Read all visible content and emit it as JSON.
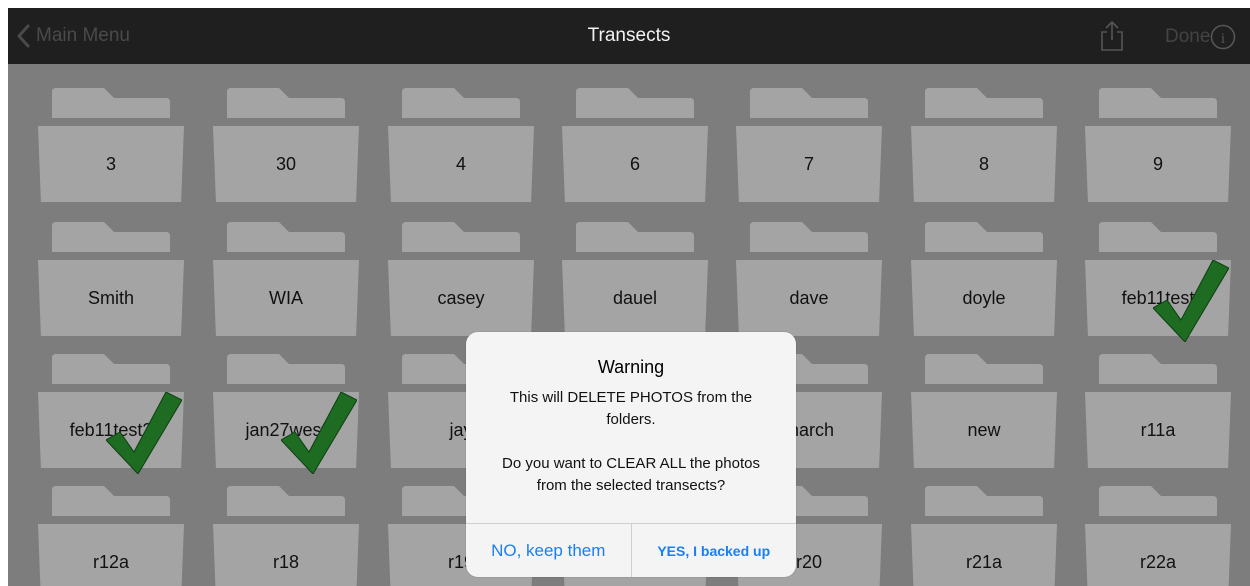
{
  "navbar": {
    "back_label": "Main Menu",
    "title": "Transects",
    "done_label": "Done",
    "share_icon": "share-icon",
    "info_icon": "info-icon"
  },
  "folders": [
    {
      "label": "3",
      "checked": false
    },
    {
      "label": "30",
      "checked": false
    },
    {
      "label": "4",
      "checked": false
    },
    {
      "label": "6",
      "checked": false
    },
    {
      "label": "7",
      "checked": false
    },
    {
      "label": "8",
      "checked": false
    },
    {
      "label": "9",
      "checked": false
    },
    {
      "label": "Smith",
      "checked": false
    },
    {
      "label": "WIA",
      "checked": false
    },
    {
      "label": "casey",
      "checked": false
    },
    {
      "label": "dauel",
      "checked": false
    },
    {
      "label": "dave",
      "checked": false
    },
    {
      "label": "doyle",
      "checked": false
    },
    {
      "label": "feb11test",
      "checked": true
    },
    {
      "label": "feb11test2",
      "checked": true
    },
    {
      "label": "jan27west",
      "checked": true
    },
    {
      "label": "jay",
      "checked": false
    },
    {
      "label": "",
      "checked": false
    },
    {
      "label": "march",
      "checked": false
    },
    {
      "label": "new",
      "checked": false
    },
    {
      "label": "r11a",
      "checked": false
    },
    {
      "label": "r12a",
      "checked": false
    },
    {
      "label": "r18",
      "checked": false
    },
    {
      "label": "r19",
      "checked": false
    },
    {
      "label": "",
      "checked": false
    },
    {
      "label": "r20",
      "checked": false
    },
    {
      "label": "r21a",
      "checked": false
    },
    {
      "label": "r22a",
      "checked": false
    }
  ],
  "dialog": {
    "title": "Warning",
    "message": "This will DELETE PHOTOS from the folders.\n\nDo you want to CLEAR ALL the photos from the selected transects?",
    "cancel_label": "NO, keep them",
    "confirm_label": "YES, I backed up"
  },
  "colors": {
    "accent": "#1a7ef5",
    "check": "#1e6b22",
    "folder": "#a4a4a4"
  }
}
